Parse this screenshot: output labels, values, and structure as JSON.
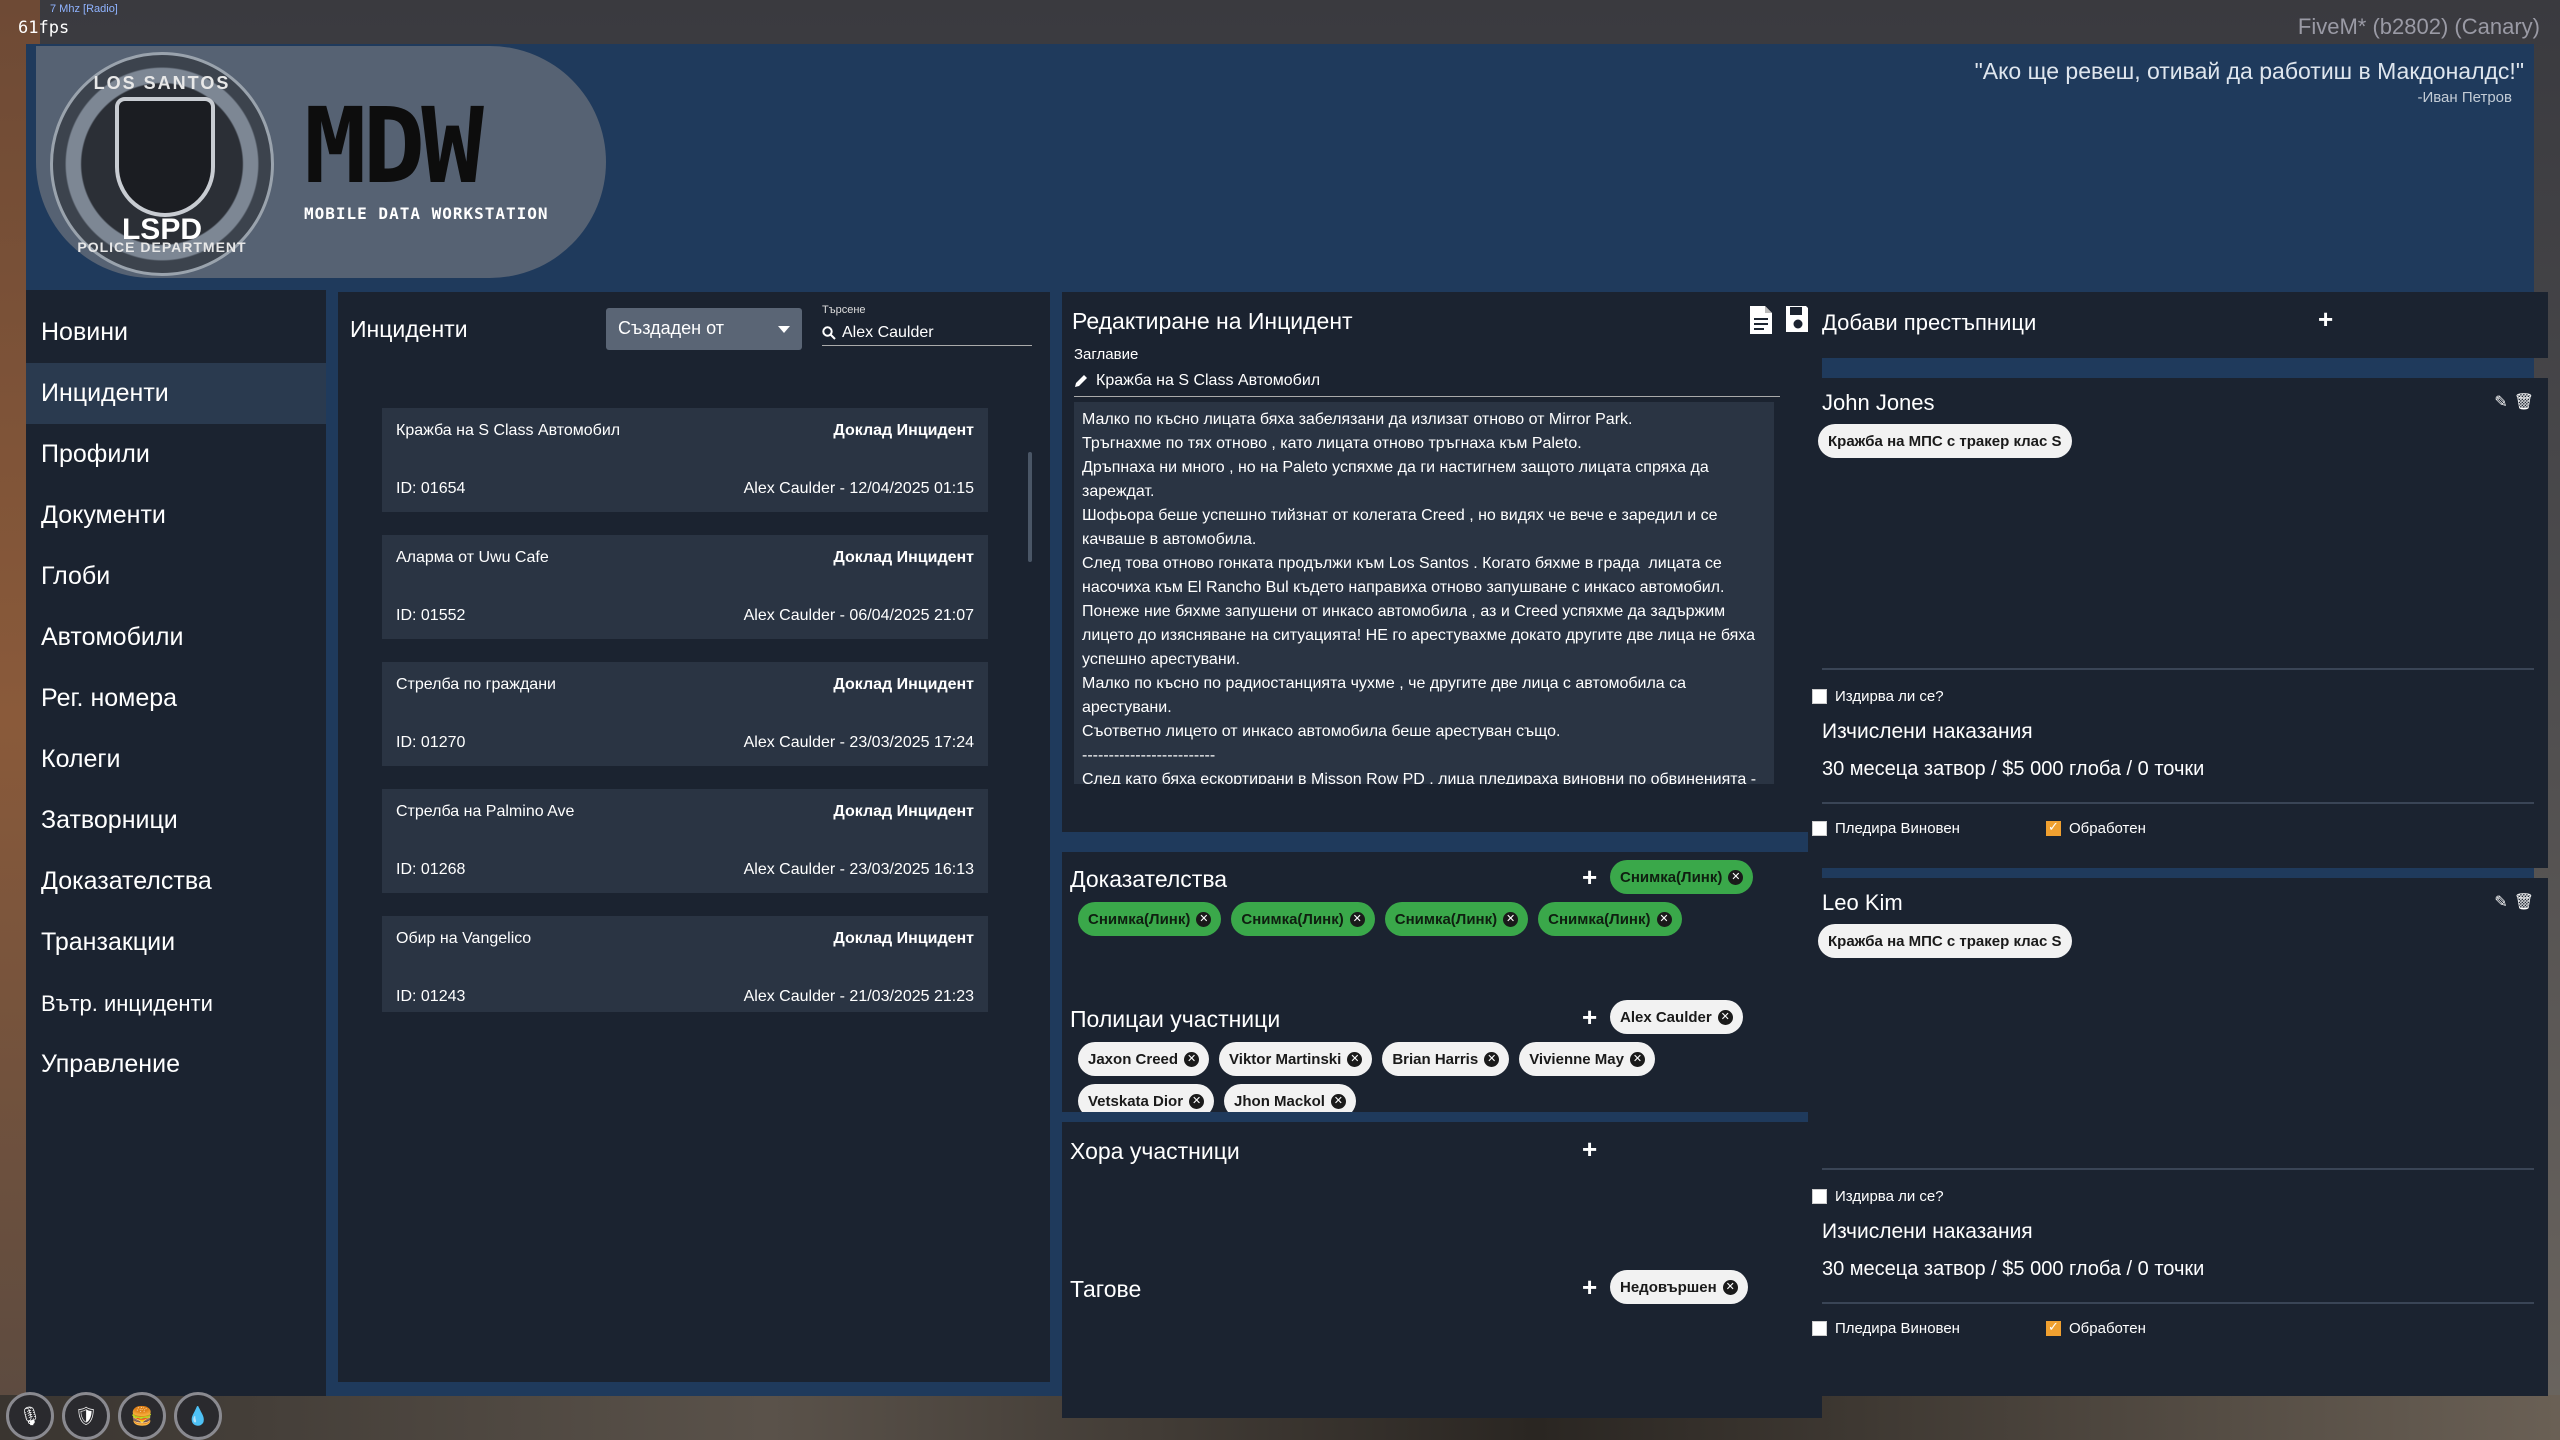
{
  "overlay": {
    "fps": "61fps",
    "radio": "7 Mhz [Radio]",
    "client": "FiveM* (b2802) (Canary)"
  },
  "header": {
    "badge_top": "LOS SANTOS",
    "badge_center": "LSPD",
    "badge_bottom": "POLICE DEPARTMENT",
    "title": "MDW",
    "subtitle": "MOBILE DATA WORKSTATION",
    "quote": "\"Ако ще ревеш, отивай да работиш в Макдоналдс!\"",
    "quote_author": "-Иван Петров"
  },
  "nav": {
    "items": [
      {
        "label": "Новини"
      },
      {
        "label": "Инциденти"
      },
      {
        "label": "Профили"
      },
      {
        "label": "Документи"
      },
      {
        "label": "Глоби"
      },
      {
        "label": "Автомобили"
      },
      {
        "label": "Рег. номера"
      },
      {
        "label": "Колеги"
      },
      {
        "label": "Затворници"
      },
      {
        "label": "Доказателства"
      },
      {
        "label": "Транзакции"
      },
      {
        "label": "Вътр. инциденти"
      },
      {
        "label": "Управление"
      }
    ],
    "active": "Инциденти"
  },
  "incidents": {
    "title": "Инциденти",
    "filter_value": "Създаден от",
    "search_label": "Търсене",
    "search_value": "Alex Caulder",
    "list": [
      {
        "title": "Кражба на S Class Автомобил",
        "type": "Доклад Инцидент",
        "id": "ID: 01654",
        "meta": "Alex Caulder - 12/04/2025 01:15"
      },
      {
        "title": "Аларма от Uwu Cafe",
        "type": "Доклад Инцидент",
        "id": "ID: 01552",
        "meta": "Alex Caulder - 06/04/2025 21:07"
      },
      {
        "title": "Стрелба по граждани",
        "type": "Доклад Инцидент",
        "id": "ID: 01270",
        "meta": "Alex Caulder - 23/03/2025 17:24"
      },
      {
        "title": "Стрелба на Palmino Ave",
        "type": "Доклад Инцидент",
        "id": "ID: 01268",
        "meta": "Alex Caulder - 23/03/2025 16:13"
      },
      {
        "title": "Обир на Vangelico",
        "type": "Доклад Инцидент",
        "id": "ID: 01243",
        "meta": "Alex Caulder - 21/03/2025 21:23"
      }
    ]
  },
  "editor": {
    "title": "Редактиране на Инцидент",
    "field_label": "Заглавие",
    "incident_title": "Кражба на S Class Автомобил",
    "report": "Малко по късно лицата бяха забелязани да излизат отново от Mirror Park.\nТръгнахме по тях отново , като лицата отново тръгнаха към Paleto.\nДръпнаха ни много , но на Paleto успяхме да ги настигнем защото лицата спряха да зареждат.\nШофьора беше успешно тийзнат от колегата Creed , но видях че вече е заредил и се качваше в автомобила.\nСлед това отново гонката продължи към Los Santos . Когато бяхме в града  лицата се насочиха към El Rancho Bul където направиха отново запушване с инкасо автомобил.\nПонеже ние бяхме запушени от инкасо автомобила , аз и Creed успяхме да задържим лицето до изясняване на ситуацията! НЕ го арестувахме докато другите две лица не бяха успешно арестувани.\nМалко по късно по радиостанцията чухме , че другите две лица с автомобила са арестувани.\nСъответно лицето от инкасо автомобила беше арестуван също.\n-------------------------\nСлед като бяха ескортирани в Misson Row PD , лица пледираха виновни по обвиненията - Кражба на МПС с тракер клас S.\nЛицето |"
  },
  "evidence": {
    "title": "Доказателства",
    "chips": [
      "Снимка(Линк)",
      "Снимка(Линк)",
      "Снимка(Линк)",
      "Снимка(Линк)",
      "Снимка(Линк)"
    ]
  },
  "officers": {
    "title": "Полицаи участници",
    "chips": [
      "Alex Caulder",
      "Jaxon Creed",
      "Viktor Martinski",
      "Brian Harris",
      "Vivienne May",
      "Vetskata Dior",
      "Jhon Mackol"
    ]
  },
  "people": {
    "title": "Хора участници"
  },
  "tags": {
    "title": "Тагове",
    "chips": [
      "Недовършен"
    ]
  },
  "criminals": {
    "title": "Добави престъпници",
    "list": [
      {
        "name": "John Jones",
        "charge": "Кражба на МПС с тракер клас S",
        "wanted_label": "Издирва ли се?",
        "penalty_title": "Изчислени наказания",
        "penalty": "30 месеца затвор / $5 000 глоба / 0 точки",
        "guilty_label": "Пледира Виновен",
        "processed_label": "Обработен"
      },
      {
        "name": "Leo Kim",
        "charge": "Кражба на МПС с тракер клас S",
        "wanted_label": "Издирва ли се?",
        "penalty_title": "Изчислени наказания",
        "penalty": "30 месеца затвор / $5 000 глоба / 0 точки",
        "guilty_label": "Пледира Виновен",
        "processed_label": "Обработен"
      }
    ]
  }
}
